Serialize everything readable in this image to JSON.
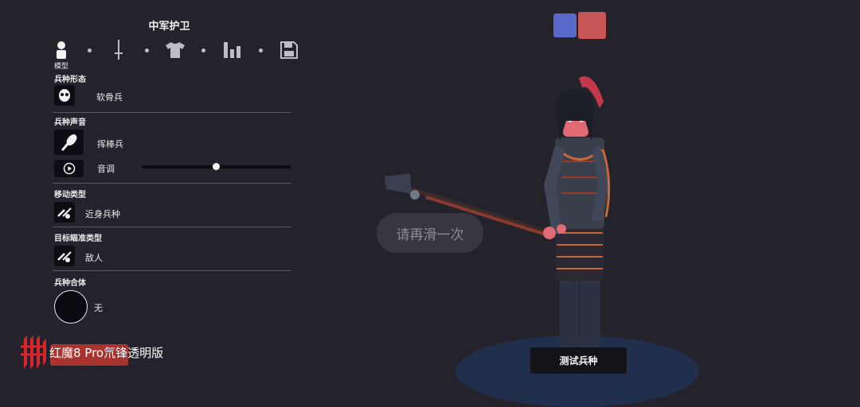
{
  "panel": {
    "title": "中军护卫",
    "tabs": [
      {
        "name": "model",
        "label": "模型",
        "active": true
      },
      {
        "name": "weapon"
      },
      {
        "name": "clothing"
      },
      {
        "name": "stats"
      },
      {
        "name": "save"
      }
    ]
  },
  "sections": {
    "unit_form": {
      "label": "兵种形态",
      "value": "软骨兵",
      "icon": "mask-icon"
    },
    "unit_voice": {
      "label": "兵种声音",
      "value": "挥棒兵",
      "icon": "club-icon",
      "pitch_label": "音调",
      "pitch_level": 0.5
    },
    "movement_type": {
      "label": "移动类型",
      "value": "近身兵种",
      "icon": "melee-icon"
    },
    "target_type": {
      "label": "目标瞄准类型",
      "value": "敌人",
      "icon": "target-enemy-icon"
    },
    "unit_combine": {
      "label": "兵种合体",
      "value": "无"
    }
  },
  "team_colors": {
    "blue": "#5869c9",
    "red": "#c65656"
  },
  "toast": "请再滑一次",
  "test_button": "测试兵种",
  "watermark": "红魔8 Pro氘锋透明版"
}
